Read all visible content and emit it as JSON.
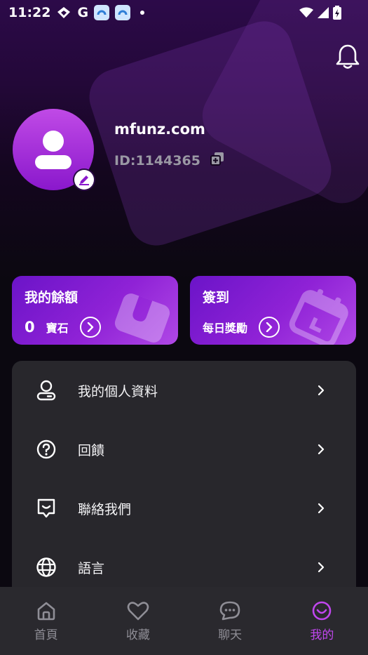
{
  "status_bar": {
    "time": "11:22",
    "g_label": "G",
    "icons": [
      "diamond-icon",
      "g-icon",
      "app-icon",
      "app-icon",
      "dot-icon",
      "wifi-icon",
      "signal-icon",
      "battery-icon"
    ]
  },
  "profile": {
    "username": "mfunz.com",
    "user_id": "ID:1144365"
  },
  "cards": {
    "balance": {
      "title": "我的餘額",
      "value": "0",
      "unit": "寶石"
    },
    "signin": {
      "title": "簽到",
      "subtitle": "每日獎勵"
    }
  },
  "menu": {
    "items": [
      {
        "label": "我的個人資料",
        "icon": "profile-icon"
      },
      {
        "label": "回饋",
        "icon": "question-icon"
      },
      {
        "label": "聯絡我們",
        "icon": "message-icon"
      },
      {
        "label": "語言",
        "icon": "globe-icon"
      }
    ]
  },
  "tabs": [
    {
      "label": "首頁",
      "icon": "home-icon",
      "active": false
    },
    {
      "label": "收藏",
      "icon": "heart-icon",
      "active": false
    },
    {
      "label": "聊天",
      "icon": "chat-icon",
      "active": false
    },
    {
      "label": "我的",
      "icon": "me-icon",
      "active": true
    }
  ],
  "colors": {
    "accent": "#c046ee",
    "card_gradient_start": "#6b14c8",
    "card_gradient_end": "#b048e6",
    "menu_bg": "#28272c",
    "tabbar_bg": "#2a292e"
  }
}
